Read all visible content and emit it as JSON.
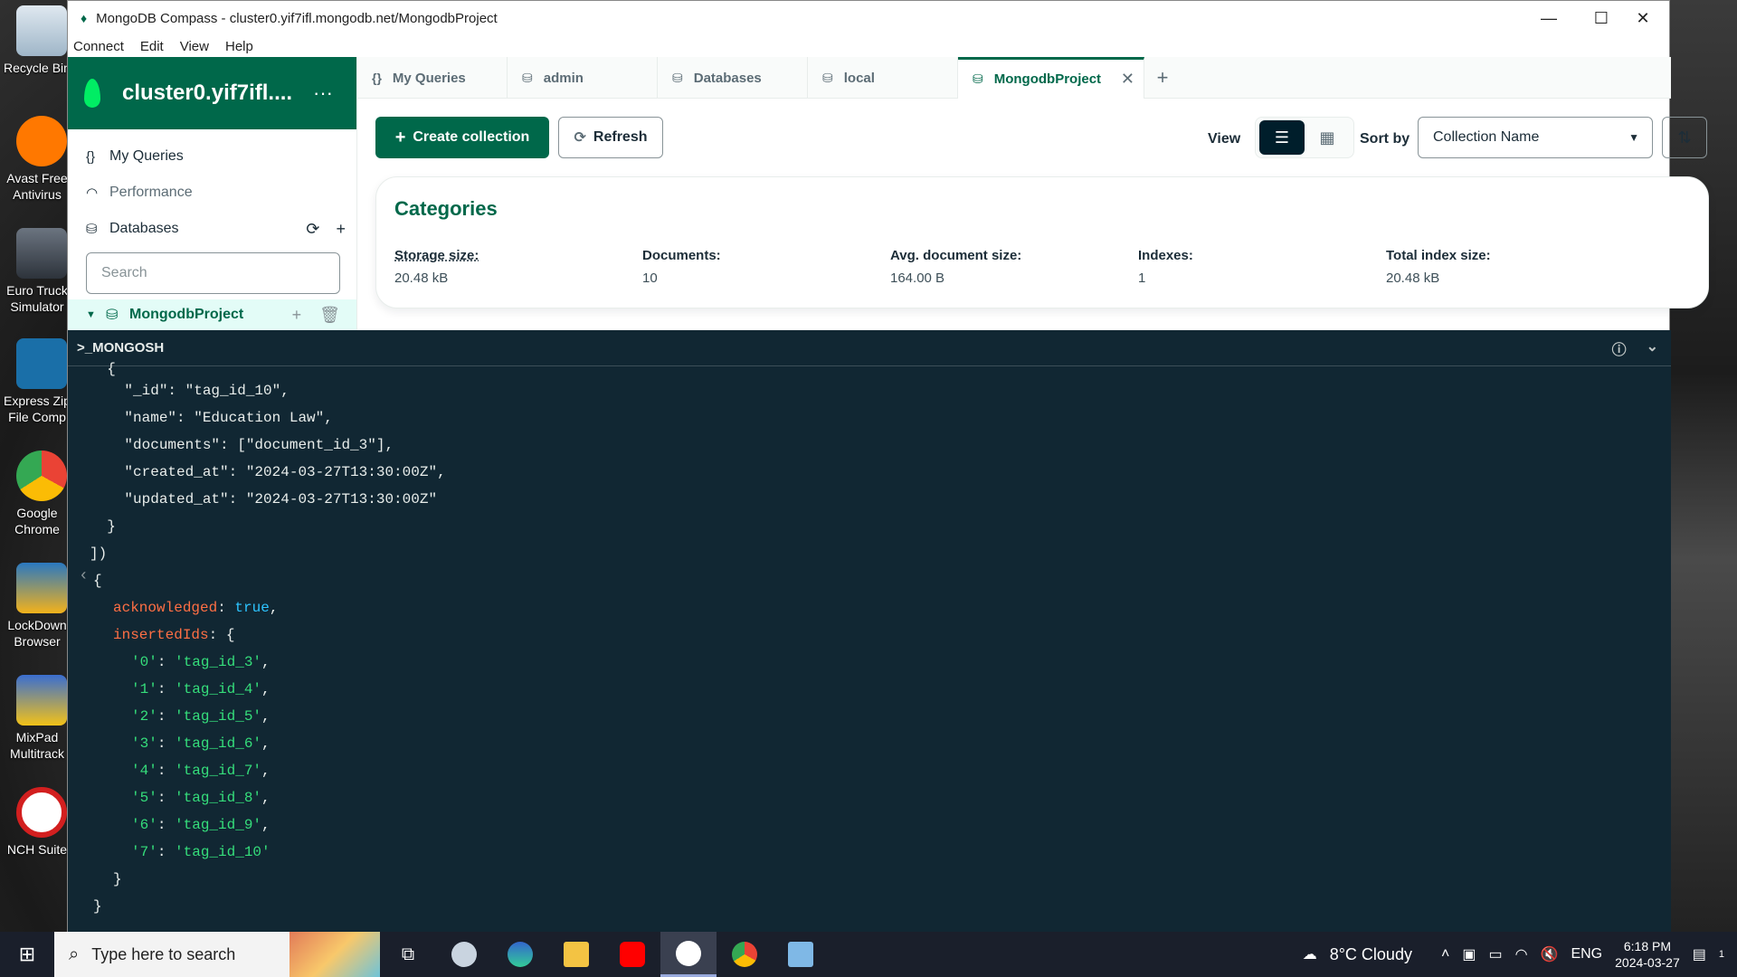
{
  "desktop": {
    "icons": [
      {
        "label1": "Recycle Bin",
        "label2": ""
      },
      {
        "label1": "Avast Free",
        "label2": "Antivirus"
      },
      {
        "label1": "Euro Truck",
        "label2": "Simulator"
      },
      {
        "label1": "Express Zip",
        "label2": "File Comp"
      },
      {
        "label1": "Google",
        "label2": "Chrome"
      },
      {
        "label1": "LockDown",
        "label2": "Browser"
      },
      {
        "label1": "MixPad",
        "label2": "Multitrack"
      },
      {
        "label1": "NCH Suite",
        "label2": ""
      }
    ]
  },
  "window": {
    "title": "MongoDB Compass - cluster0.yif7ifl.mongodb.net/MongodbProject",
    "menu": [
      "Connect",
      "Edit",
      "View",
      "Help"
    ]
  },
  "sidebar": {
    "cluster_name": "cluster0.yif7ifl....",
    "items": [
      {
        "label": "My Queries",
        "icon": "curly-braces-icon"
      },
      {
        "label": "Performance",
        "icon": "gauge-icon"
      },
      {
        "label": "Databases",
        "icon": "database-icon"
      }
    ],
    "search_placeholder": "Search",
    "active_db": "MongodbProject"
  },
  "tabs": [
    {
      "label": "My Queries",
      "icon": "{}"
    },
    {
      "label": "admin",
      "icon": "db"
    },
    {
      "label": "Databases",
      "icon": "db"
    },
    {
      "label": "local",
      "icon": "db"
    },
    {
      "label": "MongodbProject",
      "icon": "db",
      "active": true
    }
  ],
  "toolbar": {
    "create_label": "Create collection",
    "refresh_label": "Refresh",
    "view_label": "View",
    "sort_label": "Sort by",
    "sort_value": "Collection Name"
  },
  "collection_card": {
    "title": "Categories",
    "stats": [
      {
        "key": "Storage size:",
        "value": "20.48 kB"
      },
      {
        "key": "Documents:",
        "value": "10"
      },
      {
        "key": "Avg. document size:",
        "value": "164.00 B"
      },
      {
        "key": "Indexes:",
        "value": "1"
      },
      {
        "key": "Total index size:",
        "value": "20.48 kB"
      }
    ]
  },
  "shell": {
    "title": ">_MONGOSH",
    "lines": [
      "  {",
      "    \"_id\": \"tag_id_10\",",
      "    \"name\": \"Education Law\",",
      "    \"documents\": [\"document_id_3\"],",
      "    \"created_at\": \"2024-03-27T13:30:00Z\",",
      "    \"updated_at\": \"2024-03-27T13:30:00Z\"",
      "  }",
      "])"
    ],
    "result": {
      "acknowledged_key": "acknowledged",
      "acknowledged_val": "true",
      "inserted_key": "insertedIds",
      "ids": [
        {
          "k": "'0'",
          "v": "'tag_id_3'"
        },
        {
          "k": "'1'",
          "v": "'tag_id_4'"
        },
        {
          "k": "'2'",
          "v": "'tag_id_5'"
        },
        {
          "k": "'3'",
          "v": "'tag_id_6'"
        },
        {
          "k": "'4'",
          "v": "'tag_id_7'"
        },
        {
          "k": "'5'",
          "v": "'tag_id_8'"
        },
        {
          "k": "'6'",
          "v": "'tag_id_9'"
        },
        {
          "k": "'7'",
          "v": "'tag_id_10'"
        }
      ]
    }
  },
  "taskbar": {
    "search_placeholder": "Type here to search",
    "weather": "8°C  Cloudy",
    "lang": "ENG",
    "time": "6:18 PM",
    "date": "2024-03-27",
    "notif_count": "1"
  },
  "colors": {
    "brand": "#00684a",
    "shell_bg": "#112733",
    "key": "#ff6f44",
    "string": "#35de7b",
    "bool": "#2dc4ff"
  }
}
